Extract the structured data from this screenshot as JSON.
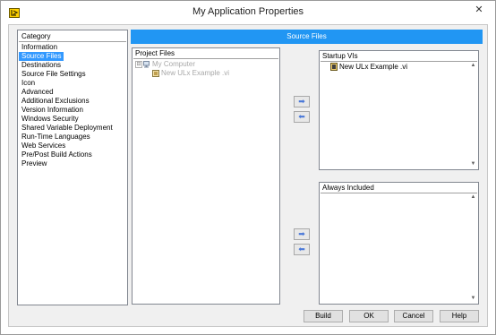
{
  "window": {
    "title": "My Application Properties",
    "close_glyph": "✕",
    "app_icon": "labview-app-icon"
  },
  "category": {
    "header": "Category",
    "items": [
      {
        "label": "Information",
        "selected": false
      },
      {
        "label": "Source Files",
        "selected": true
      },
      {
        "label": "Destinations",
        "selected": false
      },
      {
        "label": "Source File Settings",
        "selected": false
      },
      {
        "label": "Icon",
        "selected": false
      },
      {
        "label": "Advanced",
        "selected": false
      },
      {
        "label": "Additional Exclusions",
        "selected": false
      },
      {
        "label": "Version Information",
        "selected": false
      },
      {
        "label": "Windows Security",
        "selected": false
      },
      {
        "label": "Shared Variable Deployment",
        "selected": false
      },
      {
        "label": "Run-Time Languages",
        "selected": false
      },
      {
        "label": "Web Services",
        "selected": false
      },
      {
        "label": "Pre/Post Build Actions",
        "selected": false
      },
      {
        "label": "Preview",
        "selected": false
      }
    ]
  },
  "section_title": "Source Files",
  "project_files": {
    "label": "Project Files",
    "tree": [
      {
        "label": "My Computer",
        "icon": "computer-icon",
        "expander": "⊟"
      },
      {
        "label": "New ULx Example .vi",
        "icon": "vi-file-icon"
      }
    ]
  },
  "startup_vis": {
    "label": "Startup VIs",
    "items": [
      {
        "label": "New ULx Example .vi",
        "icon": "vi-file-icon"
      }
    ]
  },
  "always_included": {
    "label": "Always Included",
    "items": []
  },
  "transfer": {
    "add_glyph": "➡",
    "remove_glyph": "⬅"
  },
  "buttons": {
    "build": "Build",
    "ok": "OK",
    "cancel": "Cancel",
    "help": "Help"
  },
  "colors": {
    "accent": "#2196f3",
    "selection": "#3399ff",
    "dialog_bg": "#f0f0f0",
    "arrow": "#4a78d8"
  }
}
